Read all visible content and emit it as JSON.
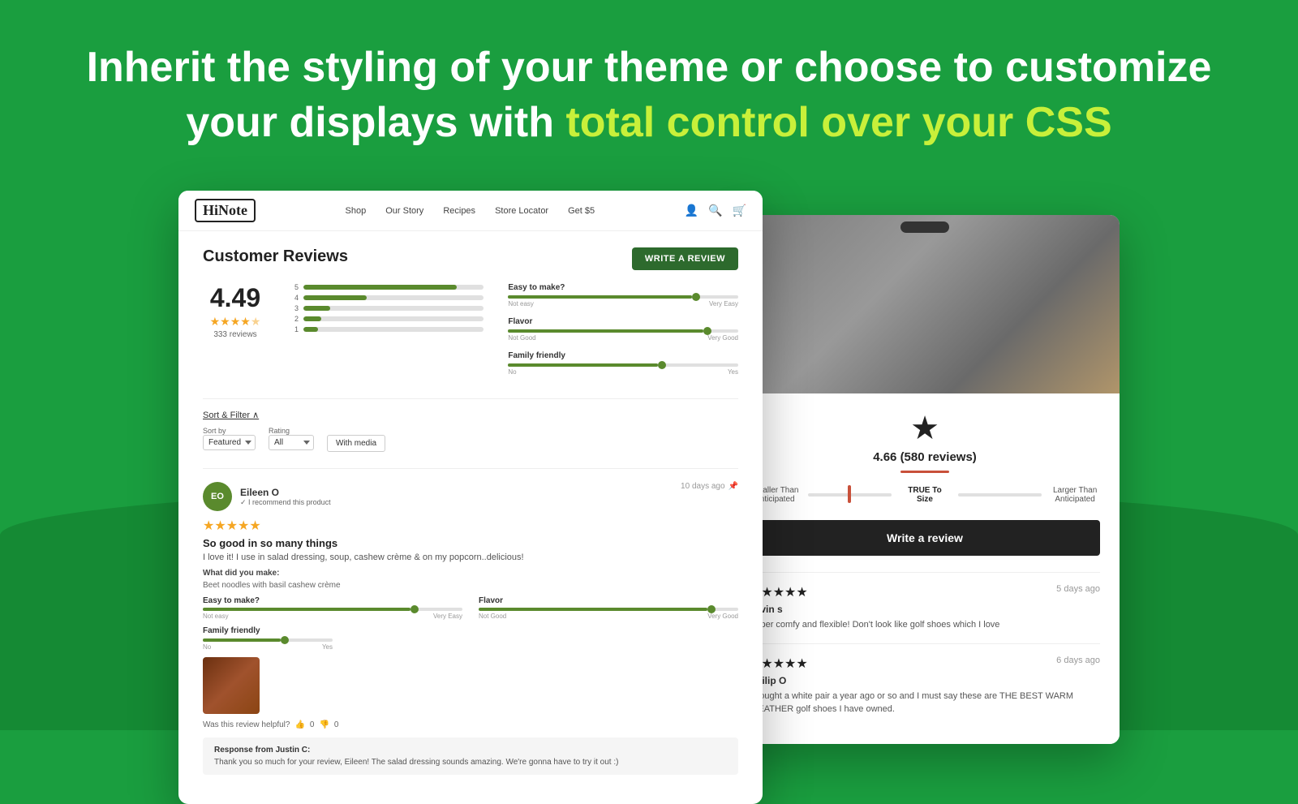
{
  "background_color": "#1a9e3f",
  "headline": {
    "line1_white": "Inherit the styling of your theme",
    "line1_separator": " or ",
    "line1_white2": "choose to customize",
    "line2_white": "your displays with ",
    "line2_highlight": "total control over your CSS"
  },
  "left_screenshot": {
    "nav": {
      "logo": "HiNote",
      "links": [
        "Shop",
        "Our Story",
        "Recipes",
        "Store Locator",
        "Get $5"
      ]
    },
    "reviews_section": {
      "title": "Customer Reviews",
      "write_button": "WRITE A REVIEW",
      "overall_rating": "4.49",
      "stars": "★★★★½",
      "review_count": "333 reviews",
      "bars": [
        {
          "num": "5",
          "pct": 85
        },
        {
          "num": "4",
          "pct": 35
        },
        {
          "num": "3",
          "pct": 15
        },
        {
          "num": "2",
          "pct": 10
        },
        {
          "num": "1",
          "pct": 8
        }
      ],
      "scales": [
        {
          "label": "Easy to make?",
          "left": "Not easy",
          "right": "Very Easy",
          "pct": 80
        },
        {
          "label": "Flavor",
          "left": "Not Good",
          "right": "Very Good",
          "pct": 85
        },
        {
          "label": "Family friendly",
          "left": "No",
          "right": "Yes",
          "pct": 65
        }
      ],
      "sort_filter_label": "Sort & Filter ∧",
      "sort_by_label": "Sort by",
      "sort_by_value": "Featured",
      "rating_label": "Rating",
      "rating_value": "All",
      "with_media": "With media",
      "review": {
        "avatar_initials": "EO",
        "reviewer_name": "Eileen O",
        "recommend": "✓ I recommend this product",
        "date": "10 days ago",
        "pin_icon": "📌",
        "stars": "★★★★★",
        "headline": "So good in so many things",
        "body": "I love it! I use in salad dressing, soup, cashew crème & on my popcorn..delicious!",
        "made_label": "What did you make:",
        "made_value": "Beet noodles with basil cashew crème",
        "scales": [
          {
            "label": "Easy to make?",
            "left": "Not easy",
            "right": "Very Easy",
            "pct": 80
          },
          {
            "label": "Flavor",
            "left": "Not Good",
            "right": "Very Good",
            "pct": 88
          },
          {
            "label": "Family friendly",
            "left": "No",
            "right": "Yes",
            "pct": 60
          }
        ],
        "helpful": "Was this review helpful?",
        "helpful_yes": "0",
        "helpful_no": "0",
        "response_from": "Response from Justin C:",
        "response_text": "Thank you so much for your review, Eileen! The salad dressing sounds amazing. We're gonna have to try it out :)"
      }
    }
  },
  "right_screenshot": {
    "rating": "4.66 (580 reviews)",
    "fit_options": {
      "smaller": "Smaller Than\nAnticipated",
      "true": "TRUE To Size",
      "larger": "Larger Than\nAnticipated"
    },
    "write_review_btn": "Write a review",
    "reviews": [
      {
        "stars": "★★★★★",
        "date": "5 days ago",
        "reviewer": "kevin s",
        "body": "Super comfy and flexible! Don't look like golf shoes which I love"
      },
      {
        "stars": "★★★★★",
        "date": "6 days ago",
        "reviewer": "Philip O",
        "body": "I bought a white pair a year ago or so and I must say these are THE BEST WARM WEATHER golf shoes I have owned."
      }
    ]
  }
}
